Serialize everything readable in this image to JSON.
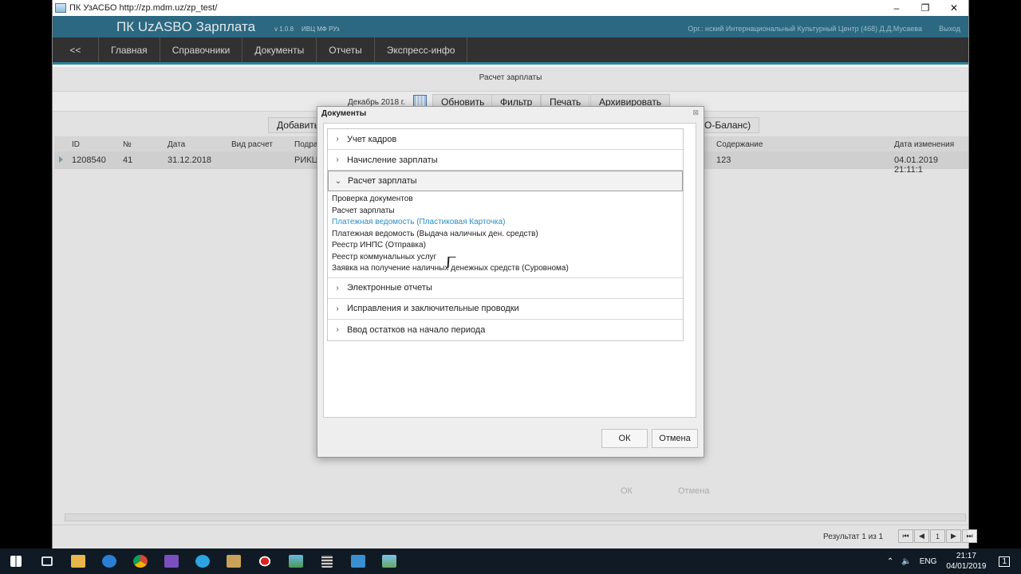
{
  "window": {
    "title": "ПК УзАСБО http://zp.mdm.uz/zp_test/",
    "controls": {
      "minimize": "–",
      "maximize": "❐",
      "close": "✕"
    }
  },
  "header": {
    "brand": "ПК UzASBO Зарплата",
    "version": "v 1.0.8",
    "org": "ИВЦ МФ РУз",
    "user": "Орг.: нский Интернациональный Культурный Центр (468) Д.Д.Мусаева",
    "logout": "Выход",
    "accent": "#2e6d87"
  },
  "nav": {
    "back": "<<",
    "items": [
      "Главная",
      "Справочники",
      "Документы",
      "Отчеты",
      "Экспресс-инфо"
    ]
  },
  "page": {
    "title": "Расчет зарплаты",
    "period": "Декабрь 2018 г.",
    "buttons": {
      "refresh": "Обновить",
      "filter": "Фильтр",
      "print": "Печать",
      "archive": "Архивировать"
    },
    "add": "Добавить",
    "balance": "О-Баланс)"
  },
  "grid": {
    "columns": [
      "ID",
      "№",
      "Дата",
      "Вид расчет",
      "Подра",
      "Содержание",
      "Дата изменения"
    ],
    "rows": [
      {
        "id": "1208540",
        "num": "41",
        "date": "31.12.2018",
        "type": "",
        "dept": "РИКЦ",
        "content": "123",
        "modified": "04.01.2019 21:11:1"
      }
    ]
  },
  "footer": {
    "result": "Результат  1  из  1",
    "pager": [
      "⏮",
      "◀",
      "1",
      "▶",
      "⏭"
    ]
  },
  "background_buttons": {
    "ok": "ОК",
    "cancel": "Отмена"
  },
  "modal": {
    "title": "Документы",
    "close": "⊠",
    "sections_before": [
      "Учет кадров",
      "Начисление зарплаты"
    ],
    "open_section": "Расчет зарплаты",
    "open_items": [
      "Проверка документов",
      "Расчет зарплаты",
      "Платежная ведомость (Пластиковая Карточка)",
      "Платежная ведомость (Выдача наличных ден. средств)",
      "Реестр ИНПС (Отправка)",
      "Реестр коммунальных услуг",
      "Заявка на получение наличных денежных средств (Суровнома)"
    ],
    "highlighted_item": 2,
    "sections_after": [
      "Электронные отчеты",
      "Исправления и заключительные проводки",
      "Ввод остатков на начало периода"
    ],
    "ok": "ОК",
    "cancel": "Отмена"
  },
  "taskbar": {
    "icons": [
      "windows-icon",
      "task-view-icon",
      "file-explorer-icon",
      "edge-icon",
      "chrome-icon",
      "visual-studio-icon",
      "telegram-icon",
      "app-icon",
      "record-icon",
      "image-viewer-icon",
      "calculator-icon",
      "remote-desktop-icon",
      "photos-icon"
    ],
    "language": "ENG",
    "time": "21:17",
    "date": "04/01/2019",
    "notifications": "1"
  }
}
